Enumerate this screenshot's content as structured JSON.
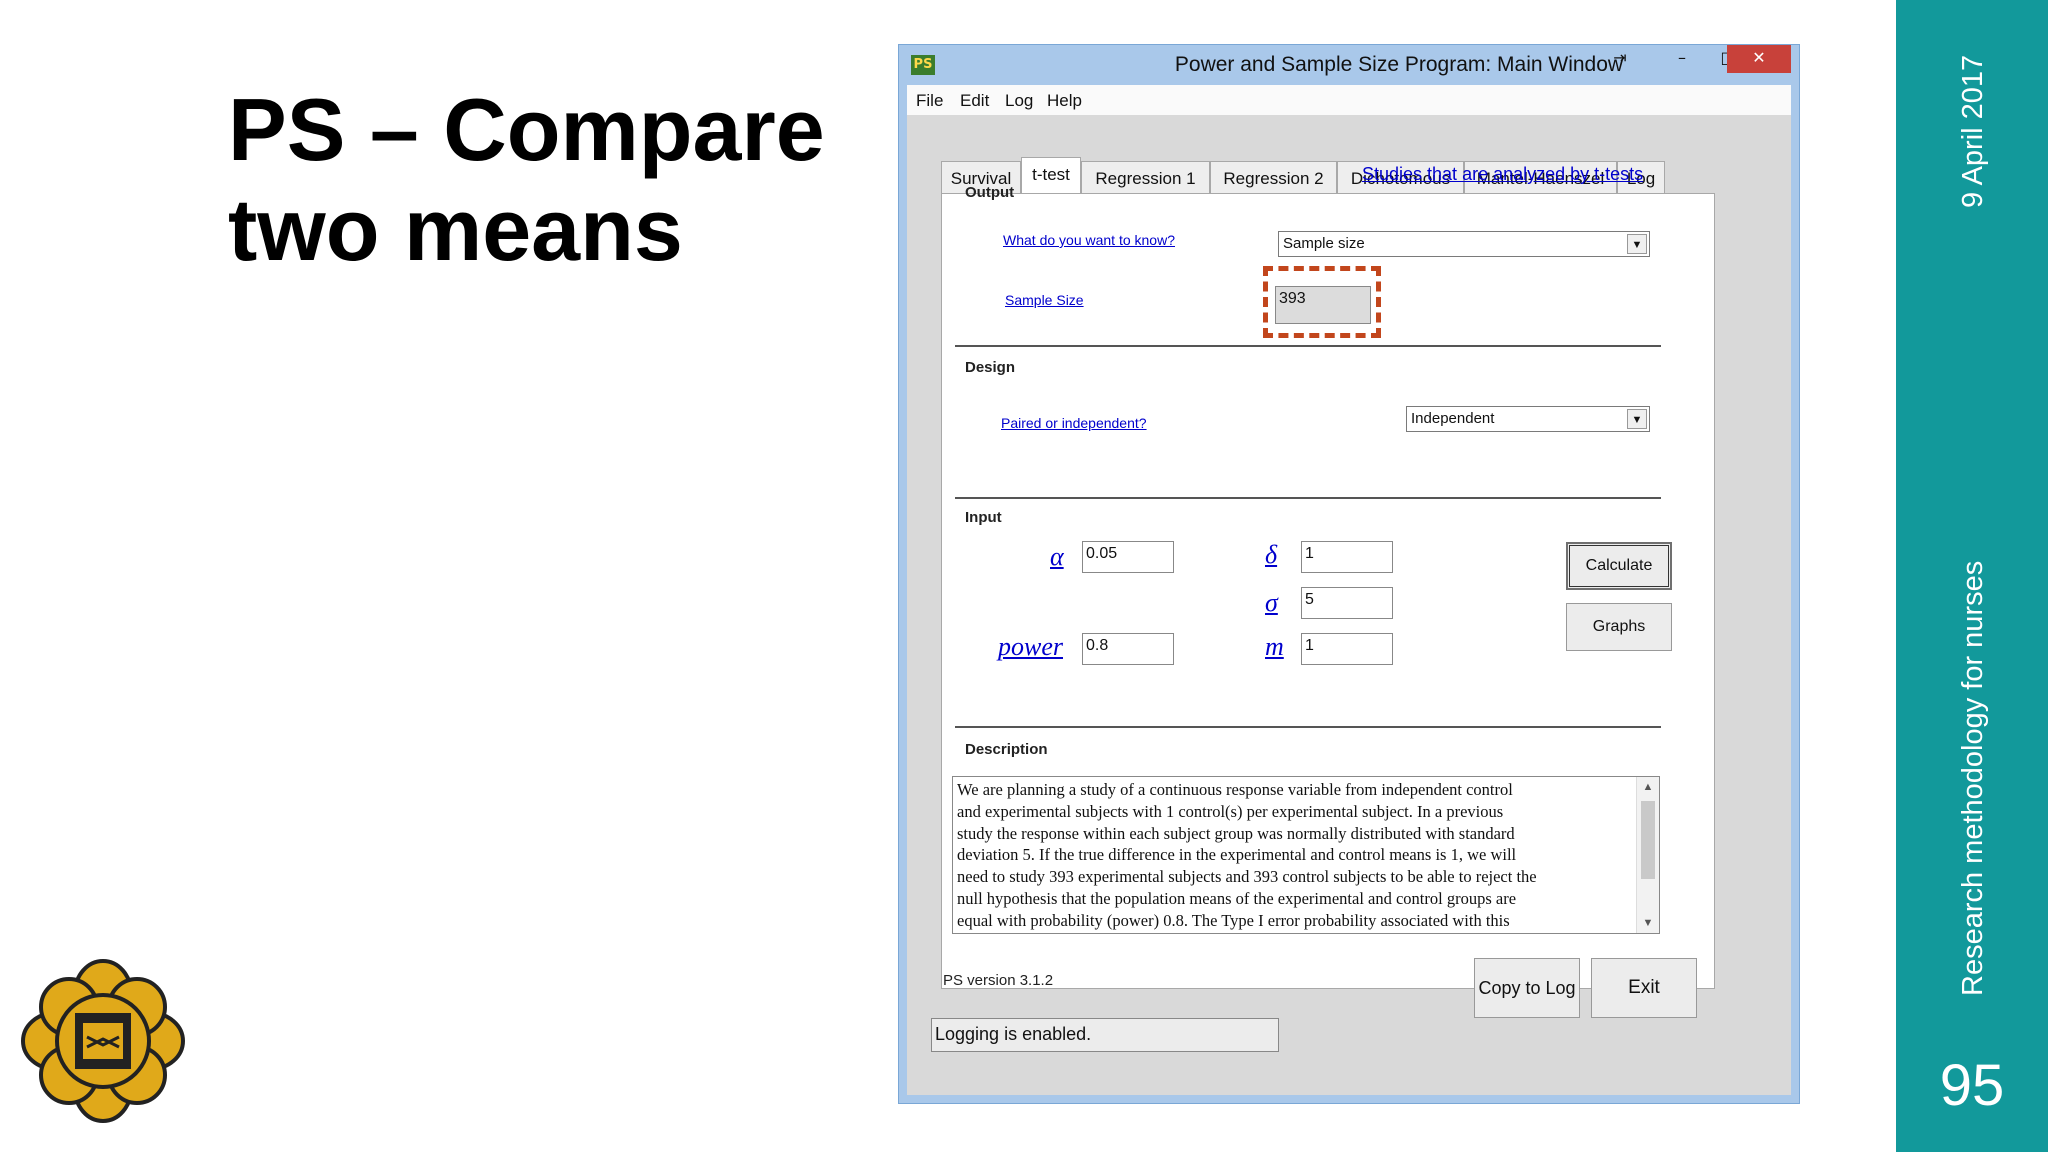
{
  "slide": {
    "title_line1": "PS – Compare",
    "title_line2": "two means",
    "date": "9 April 2017",
    "course": "Research methodology for nurses",
    "page_number": "95"
  },
  "window": {
    "title": "Power and Sample Size Program:  Main Window",
    "app_icon_text": "PS",
    "controls": {
      "minimize": "–",
      "maximize": "□",
      "close": "✕",
      "extra": "⇥"
    }
  },
  "menu": [
    "File",
    "Edit",
    "Log",
    "Help"
  ],
  "tabs": [
    "Survival",
    "t-test",
    "Regression 1",
    "Regression 2",
    "Dichotomous",
    "Mantel-Haenszel",
    "Log"
  ],
  "active_tab": "t-test",
  "output": {
    "label": "Output",
    "studies_link": "Studies that are analyzed by t-tests",
    "what_link": "What do you want to know?",
    "what_value": "Sample size",
    "sample_size_link": "Sample Size",
    "sample_size_value": "393"
  },
  "design": {
    "label": "Design",
    "paired_link": "Paired or independent?",
    "paired_value": "Independent"
  },
  "input": {
    "label": "Input",
    "alpha_symbol": "α",
    "alpha_value": "0.05",
    "power_label": "power",
    "power_value": "0.8",
    "delta_symbol": "δ",
    "delta_value": "1",
    "sigma_symbol": "σ",
    "sigma_value": "5",
    "m_symbol": "m",
    "m_value": "1",
    "calculate_label": "Calculate",
    "graphs_label": "Graphs"
  },
  "description": {
    "label": "Description",
    "lines": [
      "We are planning a study of a continuous response variable from independent control",
      "and experimental subjects with 1 control(s) per experimental subject.  In a previous",
      "study the response within each subject group was normally distributed with standard",
      "deviation 5.  If the true difference in the experimental and control means is 1, we will",
      "need to study 393 experimental subjects and 393 control subjects to be able to reject the",
      "null hypothesis that the population means of the experimental and control groups are",
      "equal with probability (power) 0.8.   The Type I error probability associated with this"
    ]
  },
  "footer": {
    "version": "PS version 3.1.2",
    "copy_to_log": "Copy to Log",
    "exit": "Exit",
    "status": "Logging is enabled."
  },
  "colors": {
    "teal_bar": "#12999b",
    "highlight": "#c2461c",
    "link": "#0000cc",
    "window_frame": "#a9c8ea",
    "close_button": "#c8413a"
  }
}
